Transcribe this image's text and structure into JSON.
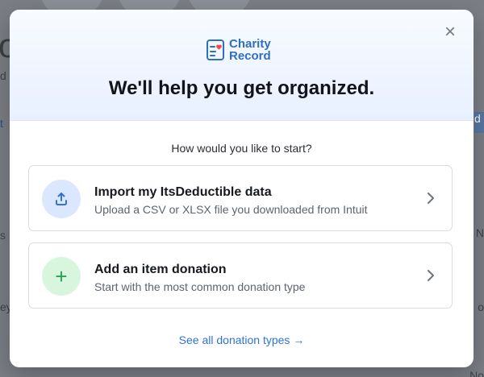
{
  "background": {
    "left_fragments": [
      "o",
      "d",
      "t",
      "s",
      "ey"
    ],
    "right_fragments": [
      "d",
      "N",
      "o",
      "No"
    ]
  },
  "modal": {
    "logo": {
      "line1": "Charity",
      "line2": "Record",
      "color": "#2f6fc0"
    },
    "title": "We'll help you get organized.",
    "close_icon": "close-icon",
    "question": "How would you like to start?",
    "options": [
      {
        "title": "Import my ItsDeductible data",
        "subtitle": "Upload a CSV or XLSX file you downloaded from Intuit",
        "icon": "upload-icon",
        "icon_bg": "#dbe7ff",
        "icon_color": "#2f73d6"
      },
      {
        "title": "Add an item donation",
        "subtitle": "Start with the most common donation type",
        "icon": "plus-icon",
        "icon_bg": "#d8f6dd",
        "icon_color": "#27a34a"
      }
    ],
    "link": "See all donation types →"
  }
}
